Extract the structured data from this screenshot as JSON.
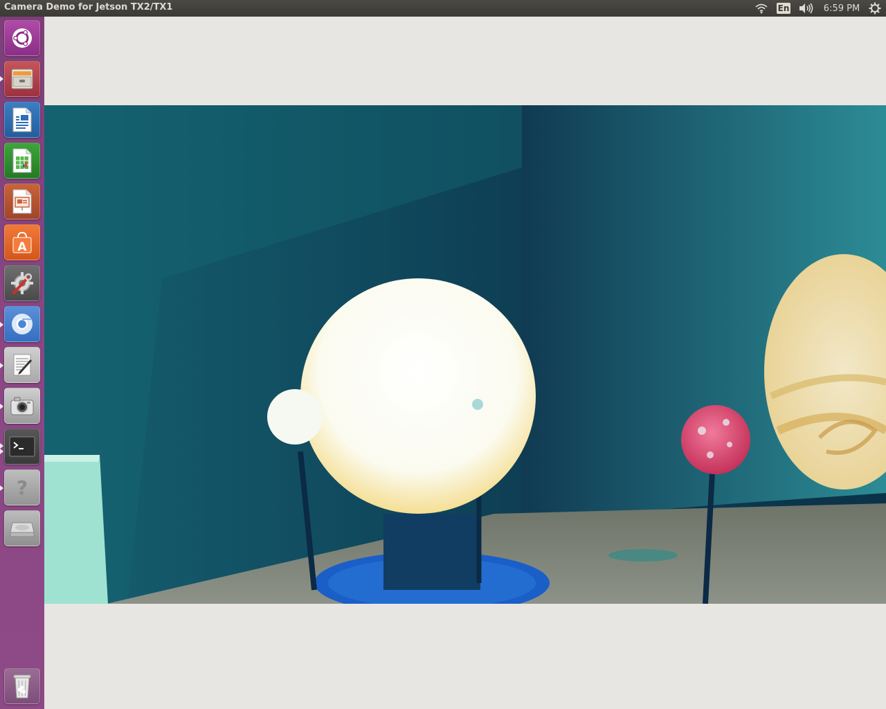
{
  "window": {
    "title": "Camera Demo for Jetson TX2/TX1"
  },
  "top_panel": {
    "keyboard_layout": "En",
    "clock": "6:59 PM",
    "indicators": [
      "wifi-icon",
      "keyboard-layout-indicator",
      "volume-icon",
      "clock",
      "system-gear-icon"
    ]
  },
  "launcher": {
    "items": [
      {
        "name": "ubuntu-dash",
        "icon": "ubuntu-logo-icon"
      },
      {
        "name": "files",
        "icon": "file-cabinet-icon"
      },
      {
        "name": "libreoffice-writer",
        "icon": "writer-document-icon"
      },
      {
        "name": "libreoffice-calc",
        "icon": "calc-spreadsheet-icon"
      },
      {
        "name": "libreoffice-impress",
        "icon": "impress-presentation-icon"
      },
      {
        "name": "ubuntu-software",
        "icon": "software-bag-icon"
      },
      {
        "name": "system-settings",
        "icon": "settings-wrench-gear-icon"
      },
      {
        "name": "chromium",
        "icon": "chromium-icon"
      },
      {
        "name": "text-editor",
        "icon": "text-editor-icon"
      },
      {
        "name": "camera-app",
        "icon": "camera-icon"
      },
      {
        "name": "terminal",
        "icon": "terminal-icon"
      },
      {
        "name": "help",
        "icon": "help-question-icon"
      },
      {
        "name": "disk-drive",
        "icon": "hard-drive-icon"
      },
      {
        "name": "trash",
        "icon": "trash-icon"
      }
    ]
  },
  "camera_view": {
    "content": "live-camera-feed"
  },
  "colors": {
    "launcher_bg": "#8a4784",
    "panel_bg": "#3c3b37",
    "window_bg": "#e8e6e3",
    "feed_wall": "#10505c"
  }
}
